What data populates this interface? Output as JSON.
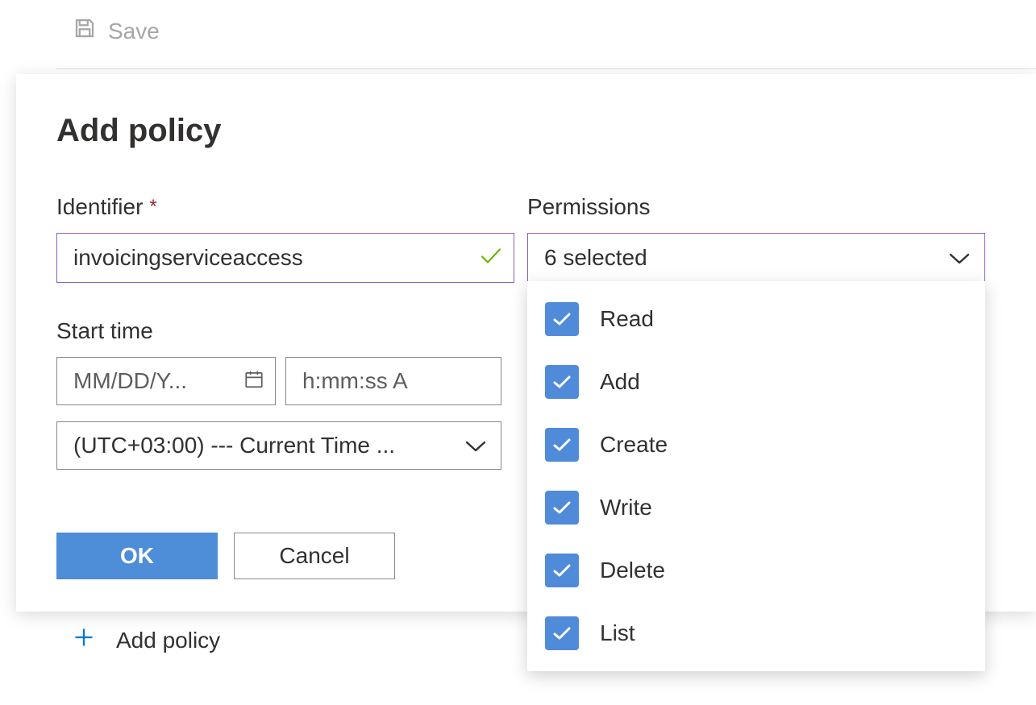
{
  "toolbar": {
    "save_label": "Save"
  },
  "modal": {
    "title": "Add policy",
    "identifier_label": "Identifier",
    "identifier_value": "invoicingserviceaccess",
    "start_time_label": "Start time",
    "date_placeholder": "MM/DD/Y...",
    "time_placeholder": "h:mm:ss A",
    "timezone_value": "(UTC+03:00) --- Current Time ...",
    "ok_label": "OK",
    "cancel_label": "Cancel"
  },
  "permissions": {
    "label": "Permissions",
    "selected_text": "6 selected",
    "options": [
      {
        "label": "Read",
        "checked": true
      },
      {
        "label": "Add",
        "checked": true
      },
      {
        "label": "Create",
        "checked": true
      },
      {
        "label": "Write",
        "checked": true
      },
      {
        "label": "Delete",
        "checked": true
      },
      {
        "label": "List",
        "checked": true
      }
    ]
  },
  "behind": {
    "add_policy_label": "Add policy"
  },
  "colors": {
    "accent_purple": "#8661c5",
    "primary_blue": "#4e8dd8",
    "checkbox_blue": "#4f8bd9",
    "text": "#323130",
    "muted": "#605e5c",
    "disabled": "#a6a6a6",
    "check_green": "#6bb700"
  }
}
